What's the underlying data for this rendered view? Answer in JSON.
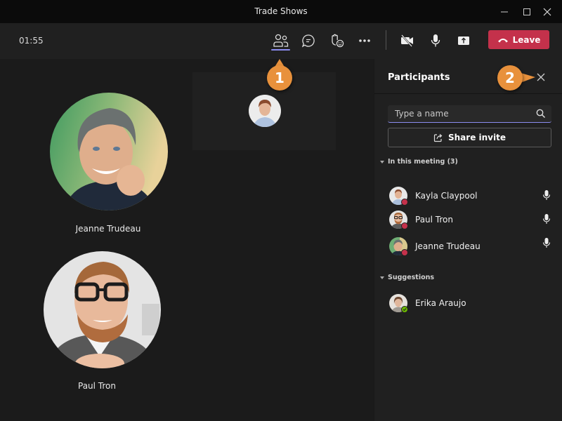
{
  "window": {
    "title": "Trade Shows",
    "controls": [
      "minimize",
      "maximize",
      "close"
    ]
  },
  "toolbar": {
    "timer": "01:55",
    "buttons": [
      {
        "name": "participants",
        "icon": "people-icon",
        "active": true
      },
      {
        "name": "chat",
        "icon": "chat-icon"
      },
      {
        "name": "reactions",
        "icon": "raise-hand-icon"
      },
      {
        "name": "more",
        "icon": "more-icon"
      },
      {
        "name": "camera",
        "icon": "camera-off-icon"
      },
      {
        "name": "mic",
        "icon": "mic-icon"
      },
      {
        "name": "share",
        "icon": "share-screen-icon"
      }
    ],
    "leave_label": "Leave",
    "leave_color": "#c4314b",
    "accent_color": "#8b8cf0"
  },
  "stage": {
    "participants": [
      {
        "name": "Jeanne Trudeau"
      },
      {
        "name": "Paul Tron"
      }
    ],
    "self_tile": {
      "name": "Kayla Claypool"
    }
  },
  "panel": {
    "title": "Participants",
    "search_placeholder": "Type a name",
    "share_invite_label": "Share invite",
    "in_meeting_header": "In this meeting (3)",
    "in_meeting": [
      {
        "name": "Kayla Claypool",
        "status": "busy",
        "mic": true
      },
      {
        "name": "Paul Tron",
        "status": "busy",
        "mic": true
      },
      {
        "name": "Jeanne Trudeau",
        "status": "busy",
        "mic": true
      }
    ],
    "suggestions_header": "Suggestions",
    "suggestions": [
      {
        "name": "Erika Araujo",
        "status": "available"
      }
    ],
    "status_colors": {
      "busy": "#c4314b",
      "available": "#6bb700"
    }
  },
  "callouts": [
    {
      "number": "1",
      "color": "#e8913c"
    },
    {
      "number": "2",
      "color": "#e8913c"
    }
  ]
}
